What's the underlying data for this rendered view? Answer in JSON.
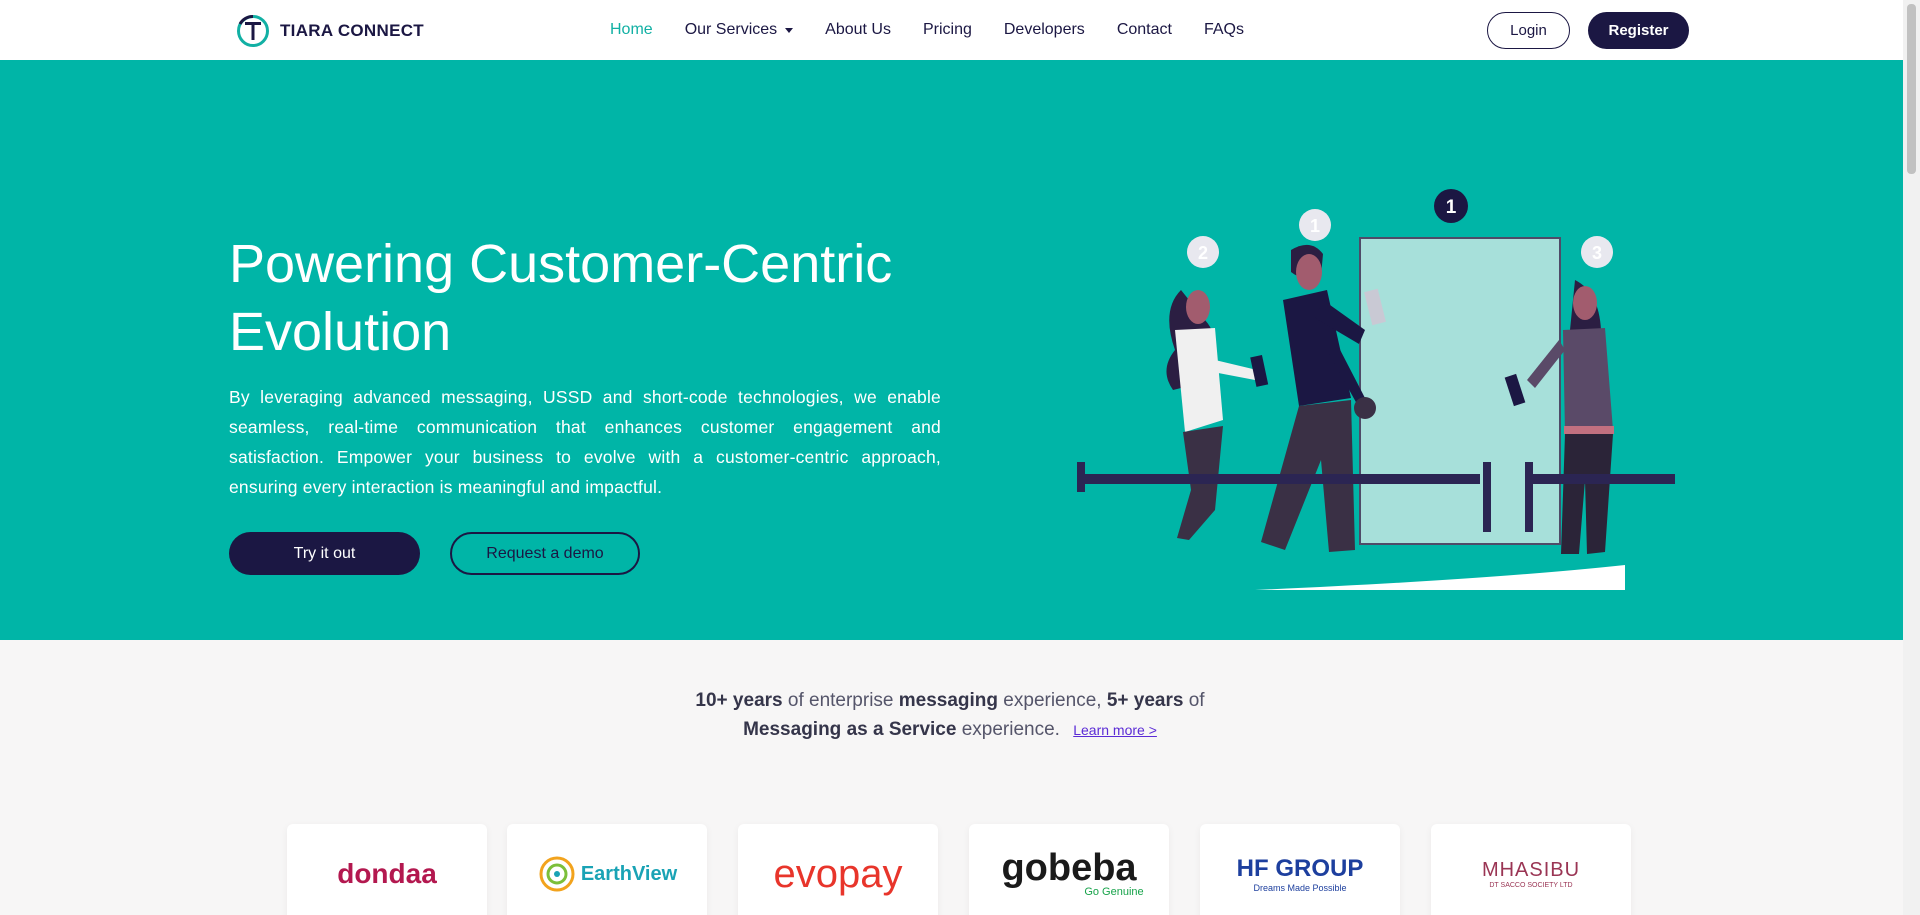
{
  "brand": {
    "name": "TIARA CONNECT",
    "icon": "tiara-connect-logo"
  },
  "nav": {
    "items": [
      {
        "label": "Home",
        "active": true
      },
      {
        "label": "Our Services",
        "dropdown": true
      },
      {
        "label": "About Us"
      },
      {
        "label": "Pricing"
      },
      {
        "label": "Developers"
      },
      {
        "label": "Contact"
      },
      {
        "label": "FAQs"
      }
    ],
    "login_label": "Login",
    "register_label": "Register"
  },
  "hero": {
    "title": "Powering Customer-Centric Evolution",
    "text": "By leveraging advanced messaging, USSD and short-code technologies, we enable seamless, real-time communication that enhances customer engagement and satisfaction. Empower your business to evolve with a customer-centric approach, ensuring every interaction is meaningful and impactful.",
    "try_label": "Try it out",
    "demo_label": "Request a demo",
    "illustration": {
      "queue_numbers": [
        "2",
        "1",
        "1",
        "3"
      ]
    }
  },
  "stats": {
    "part1_bold": "10+ years",
    "part2": " of enterprise ",
    "part3_bold": "messaging",
    "part4": " experience, ",
    "part5_bold": "5+ years",
    "part6": " of ",
    "part7_bold": "Messaging as a Service",
    "part8": " experience.",
    "learn_more": "Learn more >"
  },
  "logos": [
    {
      "name": "dondaa",
      "color": "#b3184f"
    },
    {
      "name": "EarthView",
      "color": "#1aa3b5"
    },
    {
      "name": "evopay",
      "color": "#e8352b"
    },
    {
      "name": "gobeba",
      "color": "#1a1a1a",
      "sub": "Go Genuine"
    },
    {
      "name": "HF GROUP",
      "color": "#1d3f9e",
      "sub": "Dreams Made Possible"
    },
    {
      "name": "MHASIBU",
      "color": "#9a3554",
      "sub": "DT SACCO SOCIETY LTD"
    }
  ],
  "colors": {
    "primary": "#1b1743",
    "teal": "#00b5a7",
    "accent": "#12b0a4"
  }
}
